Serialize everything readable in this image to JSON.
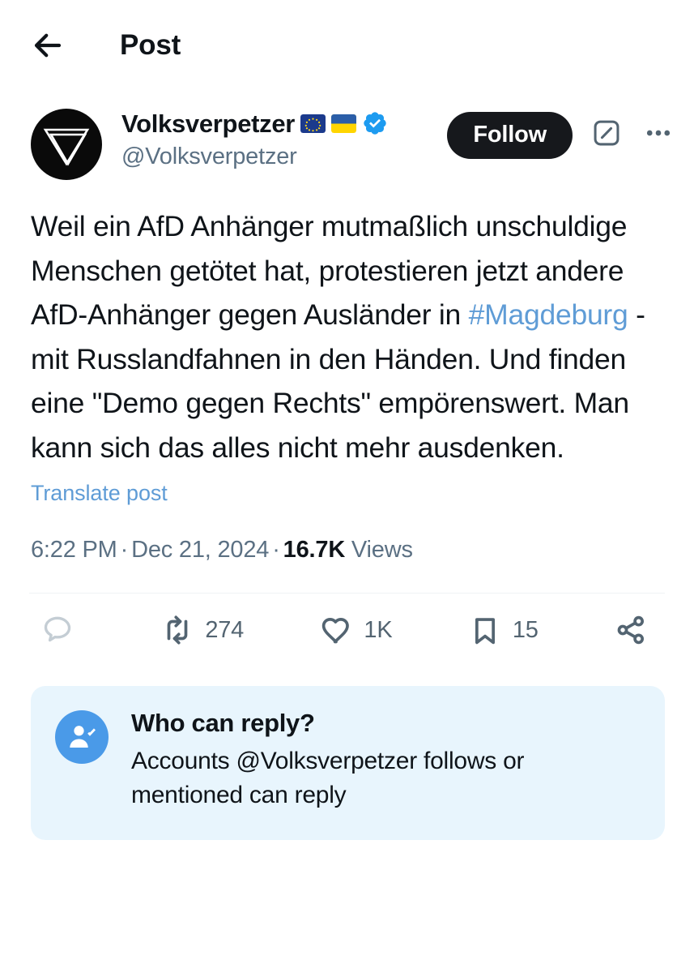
{
  "header": {
    "back_icon": "back-arrow-icon",
    "title": "Post"
  },
  "account": {
    "avatar_icon": "volksverpetzer-logo-avatar",
    "display_name": "Volksverpetzer",
    "handle": "@Volksverpetzer",
    "badges": [
      "eu-flag-emoji",
      "ukraine-flag-emoji",
      "verified-badge-icon"
    ],
    "follow_label": "Follow",
    "grok_icon": "grok-icon",
    "more_icon": "more-options-icon"
  },
  "tweet": {
    "text_part1": "Weil ein AfD Anhänger mutmaßlich unschuldige Menschen getötet hat, protestieren jetzt andere AfD-Anhänger gegen Ausländer in ",
    "hashtag": "#Magdeburg",
    "text_part2": " - mit Russlandfahnen in den Händen. Und finden eine \"Demo gegen Rechts\" empörenswert. Man kann sich das alles nicht mehr ausdenken.",
    "translate_label": "Translate post",
    "time": "6:22 PM",
    "date": "Dec 21, 2024",
    "views_count": "16.7K",
    "views_label": "Views",
    "separator": "·"
  },
  "actions": {
    "reply": {
      "icon": "reply-icon",
      "count": ""
    },
    "repost": {
      "icon": "repost-icon",
      "count": "274"
    },
    "like": {
      "icon": "like-heart-icon",
      "count": "1K"
    },
    "bookmark": {
      "icon": "bookmark-icon",
      "count": "15"
    },
    "share": {
      "icon": "share-icon",
      "count": ""
    }
  },
  "who_can_reply": {
    "icon": "person-check-icon",
    "title": "Who can reply?",
    "description": "Accounts @Volksverpetzer follows or mentioned can reply"
  },
  "colors": {
    "link_blue": "#5f9cd6",
    "verified_blue": "#1d9bf0",
    "reply_box_bg": "#e8f5fd",
    "reply_icon_bg": "#4a9ae8",
    "follow_bg": "#16181c",
    "muted_text": "#536471",
    "handle_text": "#5b7083",
    "primary_text": "#0f1419"
  }
}
